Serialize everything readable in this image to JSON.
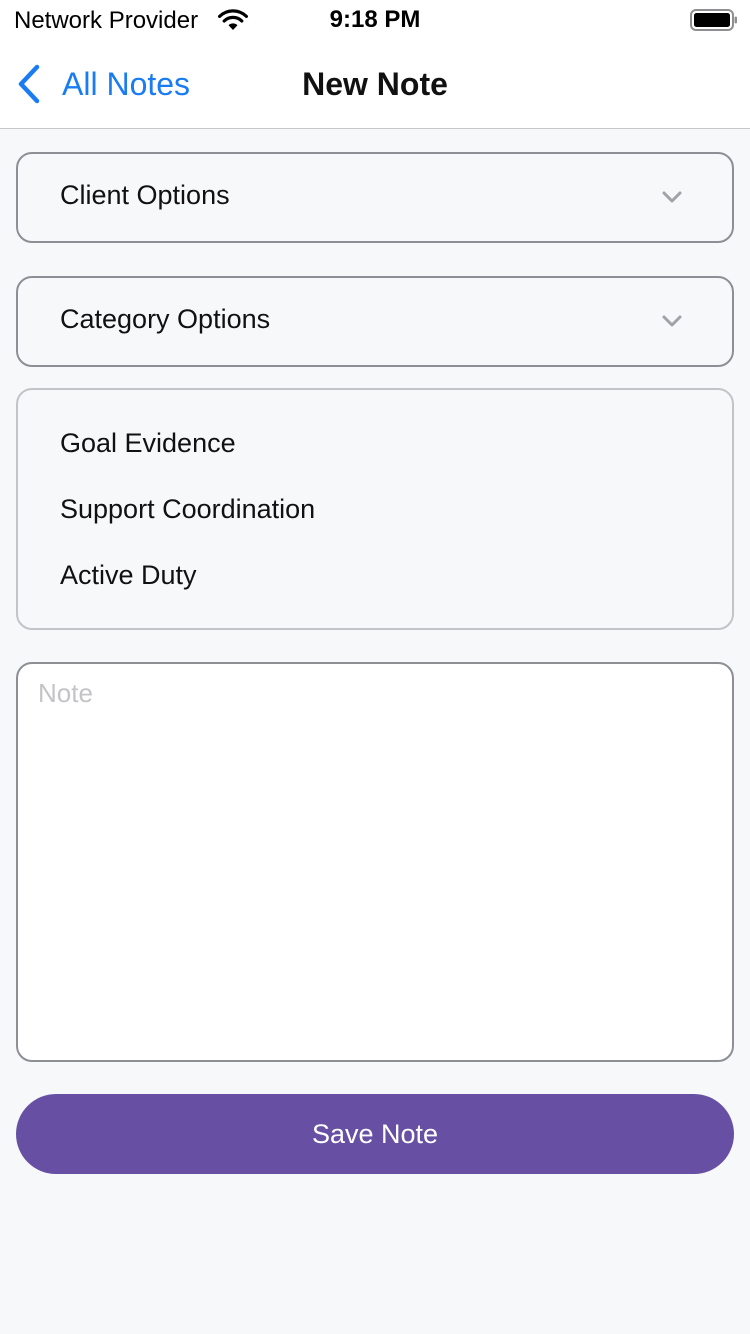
{
  "status_bar": {
    "carrier": "Network Provider",
    "time": "9:18 PM",
    "wifi_icon": "wifi-icon",
    "battery_icon": "battery-icon"
  },
  "nav": {
    "back_label": "All Notes",
    "back_icon": "chevron-left-icon",
    "title": "New Note",
    "accent_color": "#1a7cf3"
  },
  "form": {
    "client_select": {
      "label": "Client Options",
      "icon": "chevron-down-icon"
    },
    "category_select": {
      "label": "Category Options",
      "icon": "chevron-down-icon"
    },
    "categories": [
      {
        "label": "Goal Evidence"
      },
      {
        "label": "Support Coordination"
      },
      {
        "label": "Active Duty"
      }
    ],
    "note": {
      "placeholder": "Note",
      "value": ""
    },
    "save_label": "Save Note",
    "save_color": "#6750a4"
  }
}
